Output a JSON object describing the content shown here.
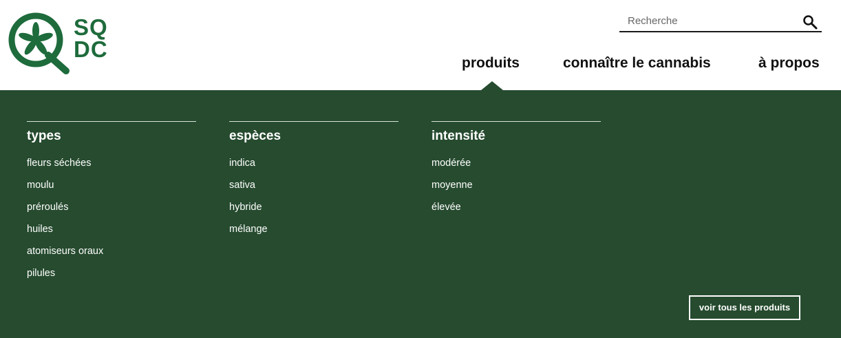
{
  "logo": {
    "line1": "SQ",
    "line2": "DC"
  },
  "search": {
    "placeholder": "Recherche",
    "icon": "search-icon"
  },
  "nav": {
    "products": "produits",
    "knowledge": "connaître le cannabis",
    "about": "à propos"
  },
  "menu": {
    "columns": [
      {
        "title": "types",
        "items": [
          "fleurs séchées",
          "moulu",
          "préroulés",
          "huiles",
          "atomiseurs oraux",
          "pilules"
        ]
      },
      {
        "title": "espèces",
        "items": [
          "indica",
          "sativa",
          "hybride",
          "mélange"
        ]
      },
      {
        "title": "intensité",
        "items": [
          "modérée",
          "moyenne",
          "élevée"
        ]
      }
    ],
    "view_all": "voir tous les produits"
  },
  "colors": {
    "brand_green": "#1e6b3c",
    "menu_bg": "#264b2f"
  }
}
